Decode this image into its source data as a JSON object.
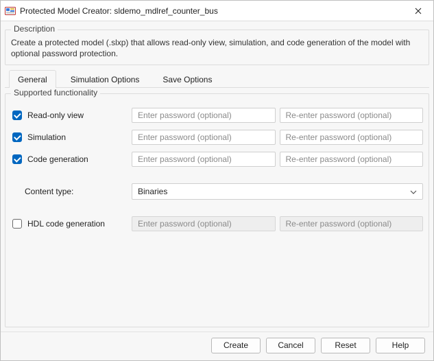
{
  "window": {
    "title": "Protected Model Creator: sldemo_mdlref_counter_bus"
  },
  "description": {
    "legend": "Description",
    "text": "Create a protected model (.slxp) that allows read-only view, simulation, and code generation of the model with optional password protection."
  },
  "tabs": {
    "general": "General",
    "simulation": "Simulation Options",
    "save": "Save Options"
  },
  "group": {
    "legend": "Supported functionality"
  },
  "rows": {
    "readonly": {
      "label": "Read-only view",
      "checked": true
    },
    "simulation": {
      "label": "Simulation",
      "checked": true
    },
    "codegen": {
      "label": "Code generation",
      "checked": true
    },
    "content": {
      "label": "Content type:",
      "value": "Binaries"
    },
    "hdl": {
      "label": "HDL code generation",
      "checked": false
    }
  },
  "placeholders": {
    "pw": "Enter password (optional)",
    "pw2": "Re-enter password (optional)"
  },
  "buttons": {
    "create": "Create",
    "cancel": "Cancel",
    "reset": "Reset",
    "help": "Help"
  }
}
